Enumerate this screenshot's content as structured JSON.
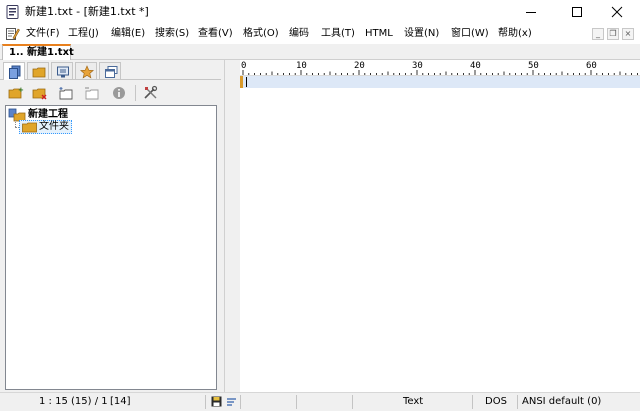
{
  "window": {
    "title": "新建1.txt - [新建1.txt *]"
  },
  "menu": {
    "items": [
      {
        "label": "文件(F)"
      },
      {
        "label": "工程(J)"
      },
      {
        "label": "编辑(E)"
      },
      {
        "label": "搜索(S)"
      },
      {
        "label": "查看(V)"
      },
      {
        "label": "格式(O)"
      },
      {
        "label": "编码"
      },
      {
        "label": "工具(T)"
      },
      {
        "label": "HTML"
      },
      {
        "label": "设置(N)"
      },
      {
        "label": "窗口(W)"
      },
      {
        "label": "帮助(x)"
      }
    ],
    "mdi_min": "_",
    "mdi_restore": "❐",
    "mdi_close": "×"
  },
  "doc_tab": {
    "label": "1.. 新建1.txt"
  },
  "project_tree": {
    "root_label": "新建工程",
    "child_label": "文件夹"
  },
  "ruler": {
    "labels": [
      "0",
      "10",
      "20",
      "30",
      "40",
      "50",
      "60"
    ]
  },
  "status": {
    "position": "1 : 15 (15) / 1",
    "selection": "[14]",
    "type": "Text",
    "line_ending": "DOS",
    "encoding": "ANSI default (0)"
  },
  "colors": {
    "accent_tab": "#e8801d",
    "current_line": "#dde8f7",
    "folder": "#e0a52a"
  }
}
